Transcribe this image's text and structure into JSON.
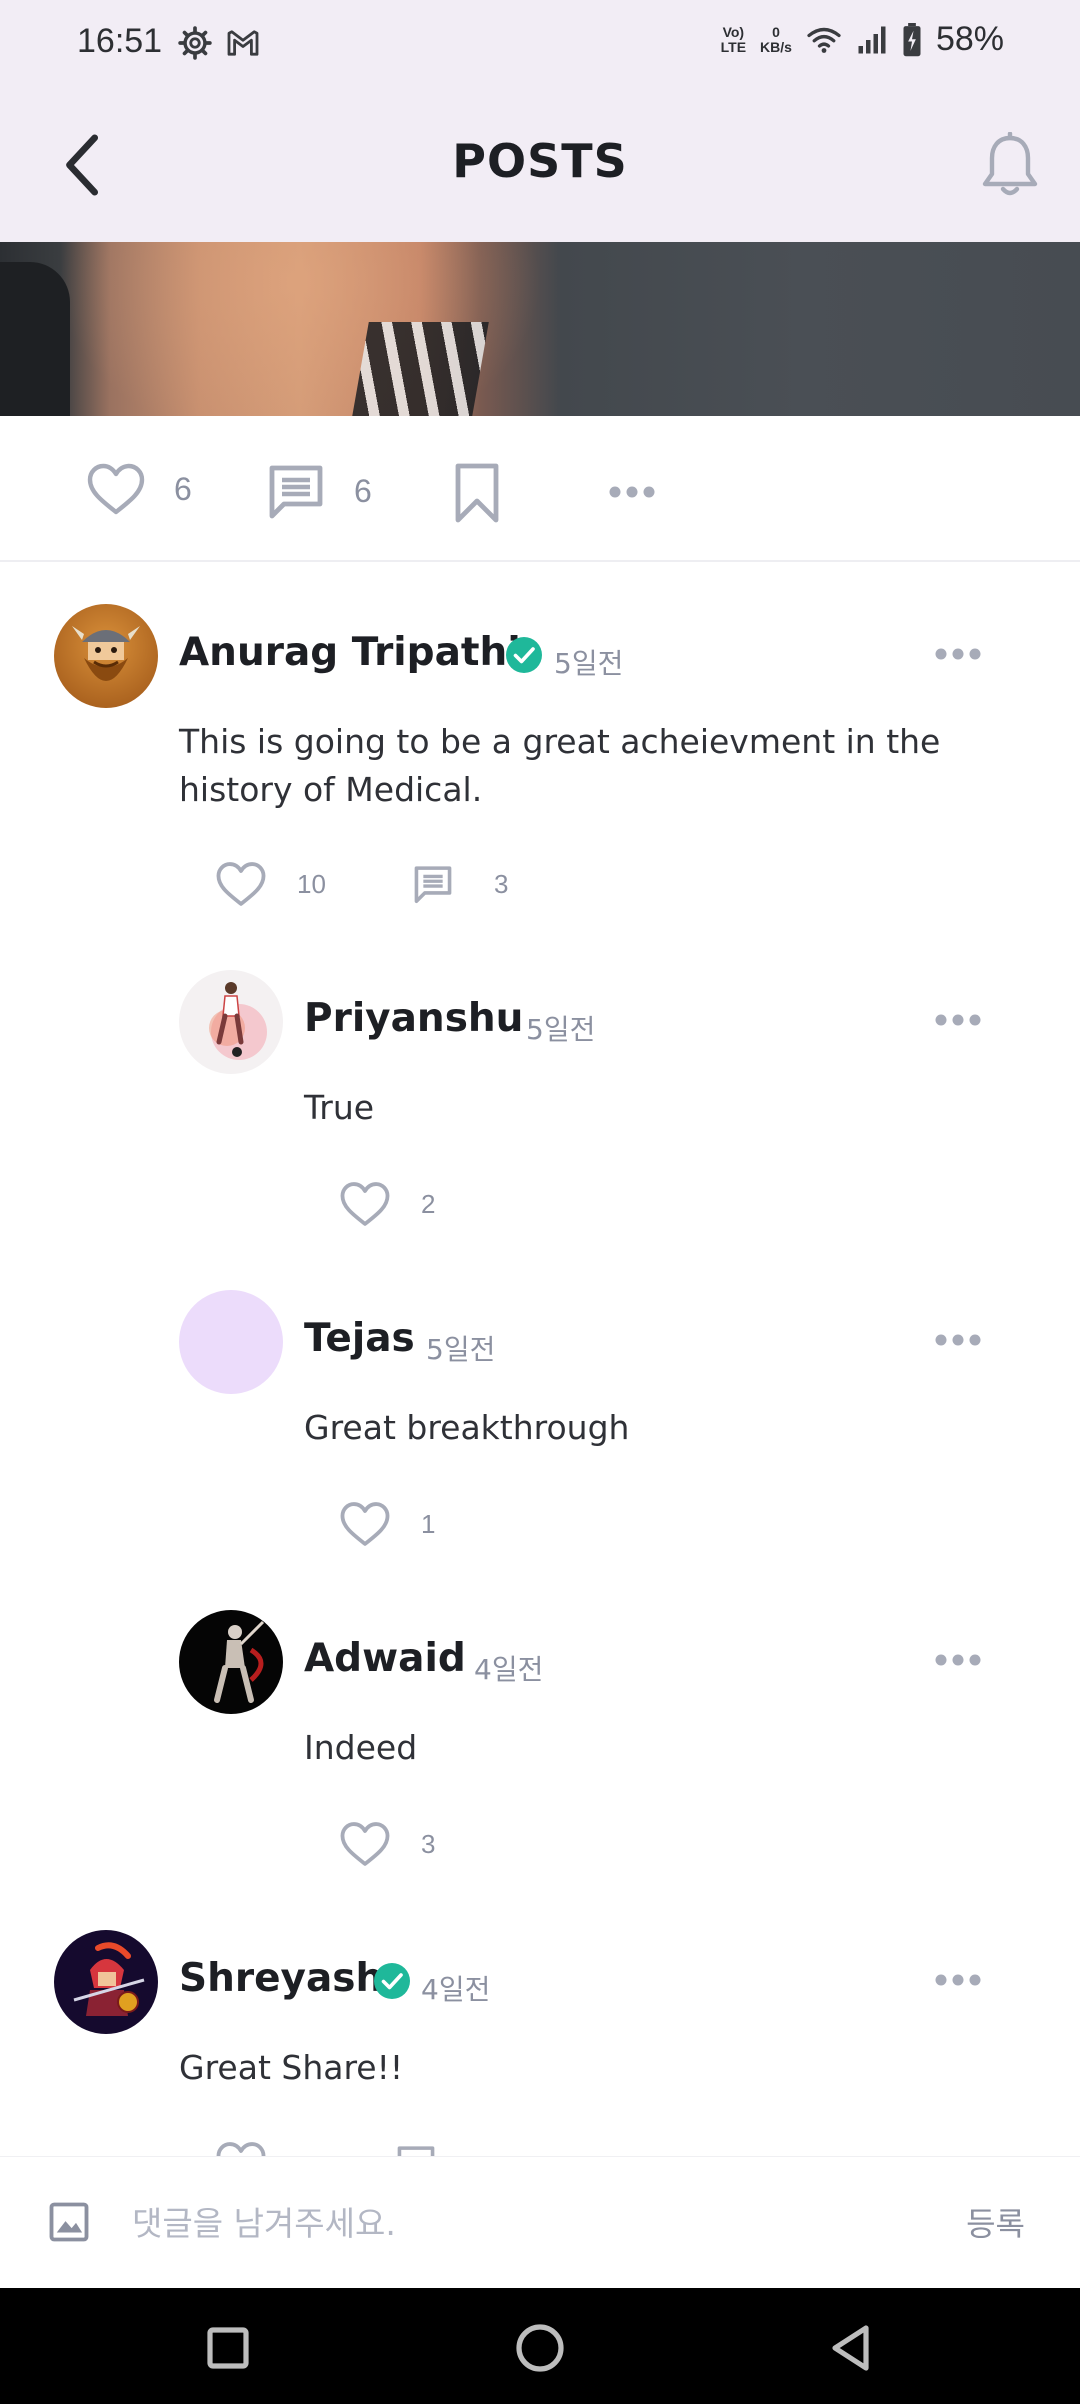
{
  "status_bar": {
    "time": "16:51",
    "net_speed_top": "0",
    "net_speed_unit": "KB/s",
    "volte_top": "Vo)",
    "volte_bottom": "LTE",
    "battery": "58%"
  },
  "app_bar": {
    "title": "POSTS"
  },
  "post_actions": {
    "likes": "6",
    "comments": "6"
  },
  "comments": [
    {
      "name": "Anurag Tripathi",
      "verified": true,
      "time": "5일전",
      "text": "This is going to be a great acheievment in the history of Medical.",
      "likes": "10",
      "replies": "3"
    },
    {
      "name": "Priyanshu",
      "time": "5일전",
      "text": "True",
      "likes": "2"
    },
    {
      "name": "Tejas",
      "time": "5일전",
      "text": "Great breakthrough",
      "likes": "1"
    },
    {
      "name": "Adwaid",
      "time": "4일전",
      "text": "Indeed",
      "likes": "3"
    },
    {
      "name": "Shreyash",
      "verified": true,
      "time": "4일전",
      "text": "Great Share!!"
    }
  ],
  "input_bar": {
    "placeholder": "댓글을 남겨주세요.",
    "submit_label": "등록"
  },
  "colors": {
    "accent_verified": "#1fb89a",
    "muted": "#8b90a0",
    "header_bg": "#f2edf5"
  },
  "icons": {
    "post_like": "heart-outline-icon",
    "post_comment": "comment-bubble-icon",
    "post_bookmark": "bookmark-icon",
    "post_more": "more-horizontal-icon",
    "back": "chevron-left-icon",
    "notification": "bell-icon",
    "attach": "image-icon"
  }
}
